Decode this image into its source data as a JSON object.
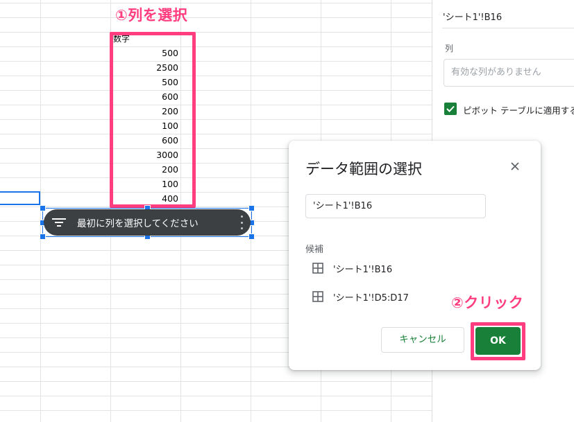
{
  "sheet": {
    "column_header": "数字",
    "values": [
      "500",
      "2500",
      "500",
      "600",
      "200",
      "100",
      "600",
      "3000",
      "200",
      "100",
      "400"
    ]
  },
  "annotations": {
    "step1": "①列を選択",
    "step2": "②クリック"
  },
  "filter_chip": {
    "label": "最初に列を選択してください",
    "icon": "filter-icon"
  },
  "side_panel": {
    "range": "'シート1'!B16",
    "column_label": "列",
    "column_placeholder": "有効な列がありません",
    "checkbox_label": "ピボット テーブルに適用する",
    "checkbox_checked": true
  },
  "dialog": {
    "title": "データ範囲の選択",
    "range_value": "'シート1'!B16",
    "candidates_label": "候補",
    "candidates": [
      "'シート1'!B16",
      "'シート1'!D5:D17"
    ],
    "cancel_label": "キャンセル",
    "ok_label": "OK"
  },
  "colors": {
    "accent_green": "#188038",
    "annotation_pink": "#ff3d7f",
    "selection_blue": "#1a73e8",
    "chip_bg": "#3c4043"
  }
}
